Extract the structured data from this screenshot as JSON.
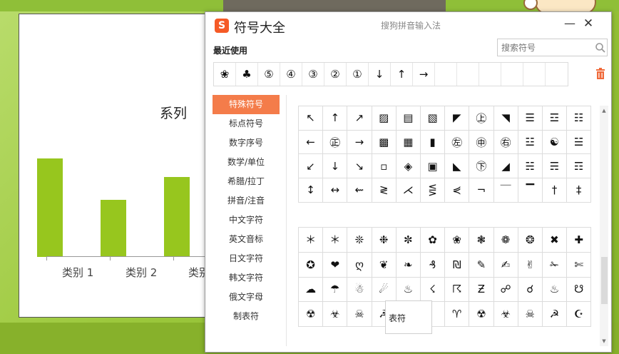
{
  "slide": {
    "chart_title": "系列",
    "categories": [
      "类别 1",
      "类别 2",
      "类别"
    ]
  },
  "chart_data": {
    "type": "bar",
    "title": "系列",
    "categories": [
      "类别 1",
      "类别 2",
      "类别"
    ],
    "values": [
      4.3,
      2.5,
      3.5
    ],
    "ylim": [
      0,
      5
    ]
  },
  "colors": {
    "bar": "#97c61e",
    "accent": "#f47c4a",
    "logo": "#f55a26"
  },
  "dialog": {
    "logo_letter": "S",
    "title": "符号大全",
    "ime_name": "搜狗拼音输入法",
    "min_glyph": "—",
    "close_glyph": "✕",
    "recent_label": "最近使用",
    "search_placeholder": "搜索符号",
    "recent_symbols": [
      "❀",
      "♣",
      "⑤",
      "④",
      "③",
      "②",
      "①",
      "↓",
      "↑",
      "→",
      "",
      "",
      "",
      "",
      "",
      ""
    ],
    "categories": [
      {
        "label": "特殊符号",
        "active": true
      },
      {
        "label": "标点符号"
      },
      {
        "label": "数字序号"
      },
      {
        "label": "数学/单位"
      },
      {
        "label": "希腊/拉丁"
      },
      {
        "label": "拼音/注音"
      },
      {
        "label": "中文字符"
      },
      {
        "label": "英文音标"
      },
      {
        "label": "日文字符"
      },
      {
        "label": "韩文字符"
      },
      {
        "label": "俄文字母"
      },
      {
        "label": "制表符"
      }
    ],
    "grid1": [
      "↖",
      "↑",
      "↗",
      "▨",
      "▤",
      "▧",
      "◤",
      "㊤",
      "◥",
      "☰",
      "☲",
      "☷",
      "←",
      "㊣",
      "→",
      "▩",
      "▦",
      "▮",
      "㊧",
      "㊥",
      "㊨",
      "☳",
      "☯",
      "☱",
      "↙",
      "↓",
      "↘",
      "▫",
      "◈",
      "▣",
      "◣",
      "㊦",
      "◢",
      "☵",
      "☴",
      "☶",
      "↕",
      "↔",
      "⇜",
      "≷",
      "⋌",
      "⋚",
      "⋞",
      "¬",
      "￣",
      "▔",
      "†",
      "‡"
    ],
    "grid2": [
      "＊",
      "＊",
      "❊",
      "❉",
      "✼",
      "✿",
      "❀",
      "❃",
      "❁",
      "❂",
      "✖",
      "✚",
      "✪",
      "❤",
      "ღ",
      "❦",
      "❧",
      "₰",
      "₪",
      "✎",
      "✍",
      "✌",
      "✁",
      "✄",
      "☁",
      "☂",
      "☃",
      "☄",
      "♨",
      "☇",
      "☈",
      "Ƶ",
      "☍",
      "☌",
      "♨",
      "☋",
      "☢",
      "☣",
      "☠",
      "☭",
      "",
      "",
      "♈",
      "☢",
      "☣",
      "☠",
      "☭",
      "☪"
    ],
    "tooltip": "表符"
  }
}
